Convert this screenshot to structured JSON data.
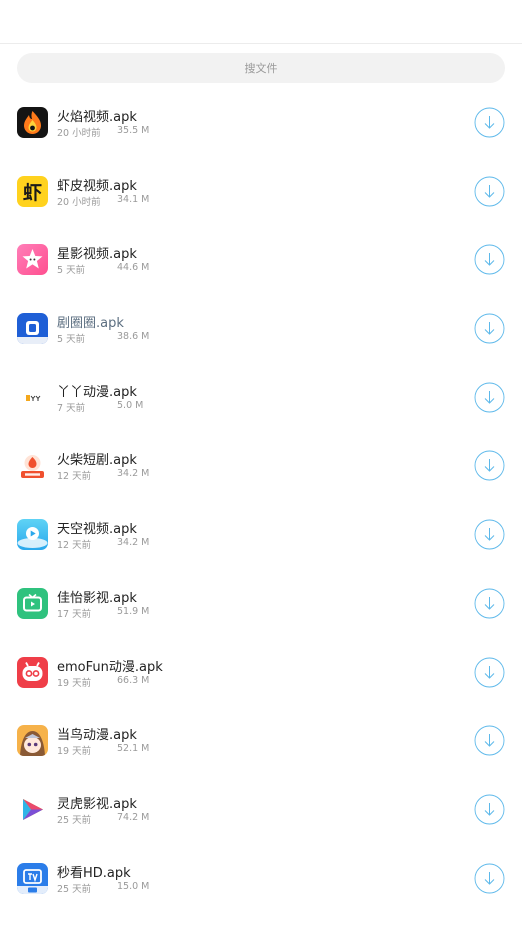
{
  "search": {
    "placeholder": "搜文件"
  },
  "colors": {
    "accent": "#5cb8ea",
    "text": "#222222",
    "meta": "#9a9a9a",
    "search_bg": "#f2f2f2"
  },
  "files": [
    {
      "name": "火焰视频.apk",
      "time": "20 小时前",
      "size": "35.5 M",
      "icon": "flame-icon"
    },
    {
      "name": "虾皮视频.apk",
      "time": "20 小时前",
      "size": "34.1 M",
      "icon": "shrimp-icon"
    },
    {
      "name": "星影视频.apk",
      "time": "5 天前",
      "size": "44.6 M",
      "icon": "star-icon"
    },
    {
      "name": "剧圈圈.apk",
      "time": "5 天前",
      "size": "38.6 M",
      "icon": "juquanquan-icon"
    },
    {
      "name": "丫丫动漫.apk",
      "time": "7 天前",
      "size": "5.0 M",
      "icon": "yaya-icon"
    },
    {
      "name": "火柴短剧.apk",
      "time": "12 天前",
      "size": "34.2 M",
      "icon": "match-icon"
    },
    {
      "name": "天空视频.apk",
      "time": "12 天前",
      "size": "34.2 M",
      "icon": "sky-icon"
    },
    {
      "name": "佳怡影视.apk",
      "time": "17 天前",
      "size": "51.9 M",
      "icon": "tv-icon"
    },
    {
      "name": "emoFun动漫.apk",
      "time": "19 天前",
      "size": "66.3 M",
      "icon": "emofun-icon"
    },
    {
      "name": "当鸟动漫.apk",
      "time": "19 天前",
      "size": "52.1 M",
      "icon": "anime-girl-icon"
    },
    {
      "name": "灵虎影视.apk",
      "time": "25 天前",
      "size": "74.2 M",
      "icon": "play-triangle-icon"
    },
    {
      "name": "秒看HD.apk",
      "time": "25 天前",
      "size": "15.0 M",
      "icon": "tv-hd-icon"
    }
  ]
}
